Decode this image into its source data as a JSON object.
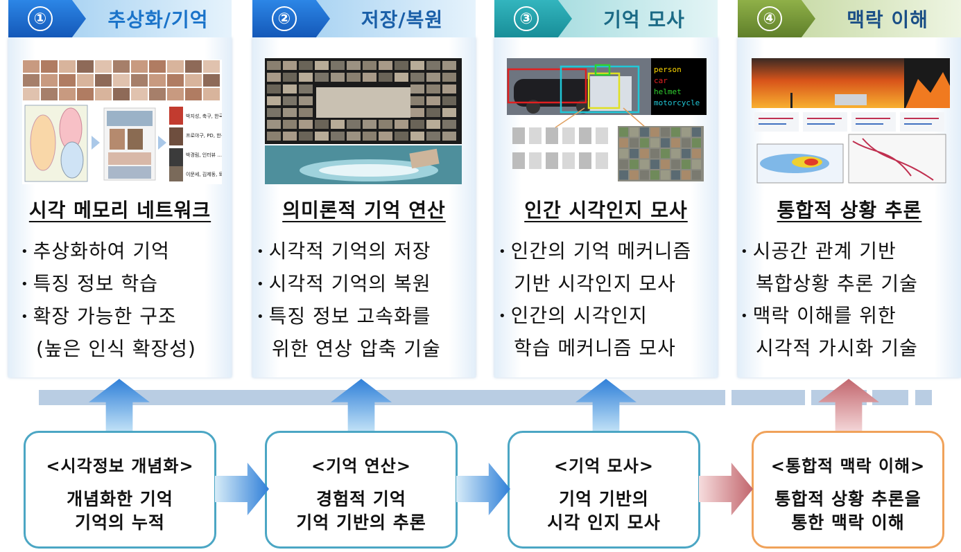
{
  "columns": [
    {
      "number": "①",
      "title": "추상화/기억",
      "heading": "시각 메모리 네트워크",
      "bullets": [
        "추상화하여 기억",
        "특징 정보 학습",
        "확장 가능한 구조"
      ],
      "extra": "(높은 인식 확장성)",
      "thumb_labels": [
        "박지성, 축구, 한국 ...",
        "프로야구, PD, 한국 ...",
        "박경림, 인터뷰 ...",
        "이문세, 김제동, 토크"
      ]
    },
    {
      "number": "②",
      "title": "저장/복원",
      "heading": "의미론적 기억 연산",
      "bullets": [
        "시각적 기억의 저장",
        "시각적 기억의 복원",
        "특징 정보 고속화를"
      ],
      "extra": "위한 연상 압축 기술"
    },
    {
      "number": "③",
      "title": "기억 모사",
      "heading": "인간 시각인지 모사",
      "bullets": [
        "인간의 기억 메커니즘",
        "인간의 시각인지"
      ],
      "continuations": [
        "기반 시각인지 모사",
        "학습 메커니즘 모사"
      ],
      "detection_labels": [
        "person",
        "car",
        "helmet",
        "motorcycle"
      ]
    },
    {
      "number": "④",
      "title": "맥락 이해",
      "heading": "통합적 상황 추론",
      "bullets": [
        "시공간 관계 기반",
        "맥락 이해를 위한"
      ],
      "continuations": [
        "복합상황 추론 기술",
        "시각적 가시화 기술"
      ]
    }
  ],
  "boxes": [
    {
      "title": "<시각정보 개념화>",
      "lines": [
        "개념화한 기억",
        "기억의 누적"
      ]
    },
    {
      "title": "<기억 연산>",
      "lines": [
        "경험적 기억",
        "기억 기반의 추론"
      ]
    },
    {
      "title": "<기억 모사>",
      "lines": [
        "기억 기반의",
        "시각 인지 모사"
      ]
    },
    {
      "title": "<통합적 맥락 이해>",
      "lines": [
        "통합적 상황 추론을",
        "통한 맥락 이해"
      ]
    }
  ],
  "colors": {
    "blue_tab": "#1f6fd0",
    "blue_tab_light": "#cfe6f8",
    "blue_title_text": "#1a73c9",
    "teal_tab": "#2aa6b0",
    "green_tab": "#7a9a3a",
    "box_border_blue": "#4ba6c4",
    "box_border_orange": "#f0a25a",
    "timeline": "#b9cde3"
  }
}
